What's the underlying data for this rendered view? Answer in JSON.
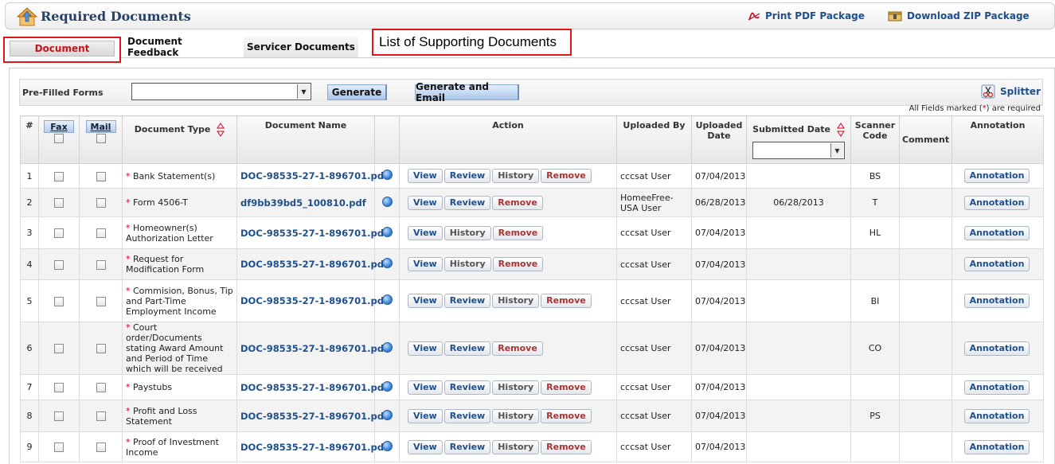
{
  "header": {
    "title": "Required Documents",
    "print_pdf": "Print PDF Package",
    "download_zip": "Download ZIP Package"
  },
  "tabs": [
    {
      "label": "Document",
      "active": true
    },
    {
      "label": "Document Feedback",
      "active": false
    },
    {
      "label": "Servicer Documents",
      "active": false
    }
  ],
  "callout": "List of Supporting Documents",
  "toolbar": {
    "prefilled_label": "Pre-Filled Forms",
    "prefilled_value": "",
    "generate": "Generate",
    "generate_email": "Generate and Email",
    "splitter": "Splitter"
  },
  "required_note": {
    "prefix": "All Fields marked (",
    "star": "*",
    "suffix": ") are required"
  },
  "columns": {
    "num": "#",
    "fax": "Fax",
    "mail": "Mail",
    "doc_type": "Document Type",
    "doc_name": "Document Name",
    "action": "Action",
    "uploaded_by": "Uploaded By",
    "uploaded_date": "Uploaded Date",
    "submitted_date": "Submitted Date",
    "scanner_code": "Scanner Code",
    "comment": "Comment",
    "annotation": "Annotation"
  },
  "action_labels": {
    "view": "View",
    "review": "Review",
    "history": "History",
    "remove": "Remove",
    "annotation": "Annotation"
  },
  "colors": {
    "accent_red": "#e0161b",
    "link_blue": "#1f4f8c",
    "required_red": "#d0021b"
  },
  "rows": [
    {
      "num": "1",
      "type": "Bank Statement(s)",
      "name": "DOC-98535-27-1-896701.pdf",
      "actions": [
        "view",
        "review",
        "history",
        "remove"
      ],
      "uploaded_by": "cccsat User",
      "uploaded_date": "07/04/2013",
      "submitted_date": "",
      "scanner": "BS",
      "comment": ""
    },
    {
      "num": "2",
      "type": "Form 4506-T",
      "name": "df9bb39bd5_100810.pdf",
      "actions": [
        "view",
        "review",
        "remove"
      ],
      "uploaded_by": "HomeeFree-USA User",
      "uploaded_date": "06/28/2013",
      "submitted_date": "06/28/2013",
      "scanner": "T",
      "comment": ""
    },
    {
      "num": "3",
      "type": "Homeowner(s) Authorization Letter",
      "name": "DOC-98535-27-1-896701.pdf",
      "actions": [
        "view",
        "history",
        "remove"
      ],
      "uploaded_by": "cccsat User",
      "uploaded_date": "07/04/2013",
      "submitted_date": "",
      "scanner": "HL",
      "comment": ""
    },
    {
      "num": "4",
      "type": "Request for Modification Form",
      "name": "DOC-98535-27-1-896701.pdf",
      "actions": [
        "view",
        "history",
        "remove"
      ],
      "uploaded_by": "cccsat User",
      "uploaded_date": "07/04/2013",
      "submitted_date": "",
      "scanner": "",
      "comment": ""
    },
    {
      "num": "5",
      "type": "Commision, Bonus, Tip and Part-Time Employment Income",
      "name": "DOC-98535-27-1-896701.pdf",
      "actions": [
        "view",
        "review",
        "history",
        "remove"
      ],
      "uploaded_by": "cccsat User",
      "uploaded_date": "07/04/2013",
      "submitted_date": "",
      "scanner": "BI",
      "comment": ""
    },
    {
      "num": "6",
      "type": "Court order/Documents stating Award Amount and Period of Time which will be received",
      "name": "DOC-98535-27-1-896701.pdf",
      "actions": [
        "view",
        "review",
        "remove"
      ],
      "uploaded_by": "cccsat User",
      "uploaded_date": "07/04/2013",
      "submitted_date": "",
      "scanner": "CO",
      "comment": ""
    },
    {
      "num": "7",
      "type": "Paystubs",
      "name": "DOC-98535-27-1-896701.pdf",
      "actions": [
        "view",
        "review",
        "history",
        "remove"
      ],
      "uploaded_by": "cccsat User",
      "uploaded_date": "07/04/2013",
      "submitted_date": "",
      "scanner": "",
      "comment": ""
    },
    {
      "num": "8",
      "type": "Profit and Loss Statement",
      "name": "DOC-98535-27-1-896701.pdf",
      "actions": [
        "view",
        "review",
        "history",
        "remove"
      ],
      "uploaded_by": "cccsat User",
      "uploaded_date": "07/04/2013",
      "submitted_date": "",
      "scanner": "PS",
      "comment": ""
    },
    {
      "num": "9",
      "type": "Proof of Investment Income",
      "name": "DOC-98535-27-1-896701.pdf",
      "actions": [
        "view",
        "review",
        "history",
        "remove"
      ],
      "uploaded_by": "cccsat User",
      "uploaded_date": "07/04/2013",
      "submitted_date": "",
      "scanner": "",
      "comment": ""
    }
  ]
}
